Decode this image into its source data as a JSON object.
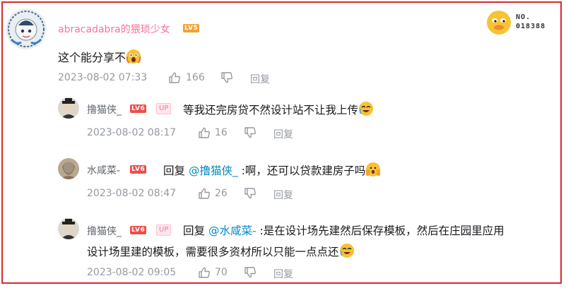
{
  "main_comment": {
    "username": "abracadabra的猥琐少女",
    "level": "LV5",
    "text": "这个能分享不",
    "time": "2023-08-02 07:33",
    "likes": "166",
    "reply_label": "回复",
    "decoration_number_label": "NO.",
    "decoration_number": "018388"
  },
  "replies": [
    {
      "username": "撸猫侠_",
      "level": "LV6",
      "badge": "UP",
      "prefix": "",
      "mention": "",
      "text": "等我还完房贷不然设计站不让我上传",
      "time": "2023-08-02 08:17",
      "likes": "16",
      "reply_label": "回复"
    },
    {
      "username": "水咸菜-",
      "level": "LV6",
      "badge": "",
      "prefix": "回复 ",
      "mention": "@撸猫侠_",
      "text": " :啊，还可以贷款建房子吗",
      "time": "2023-08-02 08:47",
      "likes": "26",
      "reply_label": "回复"
    },
    {
      "username": "撸猫侠_",
      "level": "LV6",
      "badge": "UP",
      "prefix": "回复 ",
      "mention": "@水咸菜-",
      "text": " :是在设计场先建然后保存模板，然后在庄园里应用",
      "text_line2": "设计场里建的模板，需要很多资材所以只能一点点还",
      "time": "2023-08-02 09:05",
      "likes": "70",
      "reply_label": "回复"
    }
  ],
  "colors": {
    "frame": "#d9282c",
    "pink_name": "#fb7299",
    "mention": "#008ac5",
    "meta": "#9499a0"
  },
  "icons": [
    "thumbs-up-icon",
    "thumbs-down-icon",
    "emoji-sticker-icon",
    "avatar-image"
  ]
}
